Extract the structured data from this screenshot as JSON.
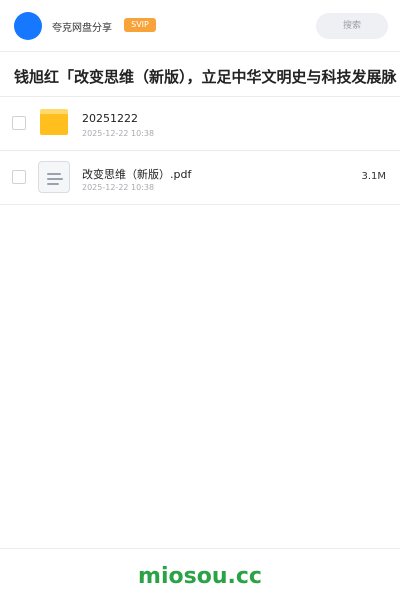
{
  "header": {
    "app_name": "夸克网盘分享",
    "badge": "SVIP",
    "search_placeholder": "搜索"
  },
  "page_title": "钱旭红「改变思维（新版），立足中华文明史与科技发展脉",
  "files": [
    {
      "type": "folder",
      "name": "20251222",
      "date": "2025-12-22 10:38",
      "size": ""
    },
    {
      "type": "pdf",
      "name": "改变思维（新版）.pdf",
      "date": "2025-12-22 10:38",
      "size": "3.1M"
    }
  ],
  "footer": {
    "brand": "miosou.cc"
  },
  "colors": {
    "avatar": "#1677ff",
    "badge": "#f7a33a",
    "brand": "#2ba245",
    "folder": "#ffc01f"
  }
}
